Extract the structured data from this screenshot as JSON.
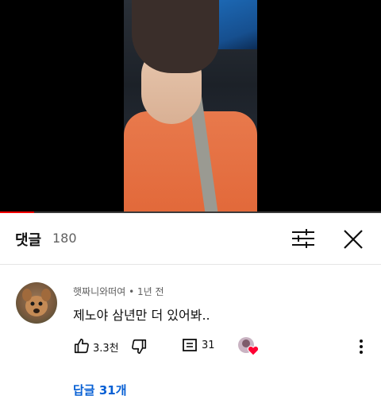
{
  "video": {
    "progress_percent": 9
  },
  "comments_panel": {
    "title": "댓글",
    "count": "180"
  },
  "comment": {
    "author": "햇짜니와떠여",
    "separator": "•",
    "time": "1년 전",
    "text": "제노야 삼년만 더 있어봐..",
    "likes": "3.3천",
    "reply_count": "31",
    "replies_link": "답글 31개"
  },
  "colors": {
    "link_blue": "#065fd4",
    "progress_red": "#ff0000",
    "heart_red": "#ff0033"
  }
}
